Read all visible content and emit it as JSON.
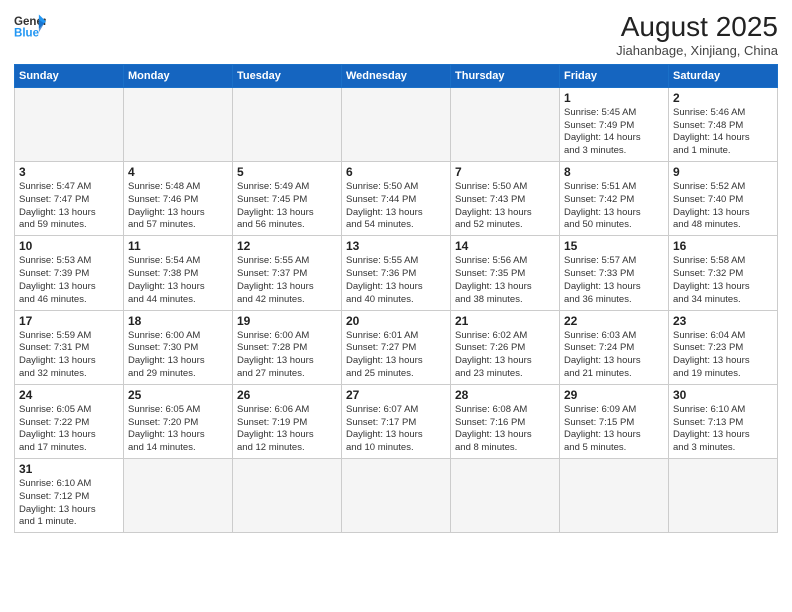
{
  "header": {
    "logo_general": "General",
    "logo_blue": "Blue",
    "month_title": "August 2025",
    "location": "Jiahanbage, Xinjiang, China"
  },
  "weekdays": [
    "Sunday",
    "Monday",
    "Tuesday",
    "Wednesday",
    "Thursday",
    "Friday",
    "Saturday"
  ],
  "days": [
    {
      "date": "",
      "info": ""
    },
    {
      "date": "",
      "info": ""
    },
    {
      "date": "",
      "info": ""
    },
    {
      "date": "",
      "info": ""
    },
    {
      "date": "",
      "info": ""
    },
    {
      "date": "1",
      "info": "Sunrise: 5:45 AM\nSunset: 7:49 PM\nDaylight: 14 hours\nand 3 minutes."
    },
    {
      "date": "2",
      "info": "Sunrise: 5:46 AM\nSunset: 7:48 PM\nDaylight: 14 hours\nand 1 minute."
    },
    {
      "date": "3",
      "info": "Sunrise: 5:47 AM\nSunset: 7:47 PM\nDaylight: 13 hours\nand 59 minutes."
    },
    {
      "date": "4",
      "info": "Sunrise: 5:48 AM\nSunset: 7:46 PM\nDaylight: 13 hours\nand 57 minutes."
    },
    {
      "date": "5",
      "info": "Sunrise: 5:49 AM\nSunset: 7:45 PM\nDaylight: 13 hours\nand 56 minutes."
    },
    {
      "date": "6",
      "info": "Sunrise: 5:50 AM\nSunset: 7:44 PM\nDaylight: 13 hours\nand 54 minutes."
    },
    {
      "date": "7",
      "info": "Sunrise: 5:50 AM\nSunset: 7:43 PM\nDaylight: 13 hours\nand 52 minutes."
    },
    {
      "date": "8",
      "info": "Sunrise: 5:51 AM\nSunset: 7:42 PM\nDaylight: 13 hours\nand 50 minutes."
    },
    {
      "date": "9",
      "info": "Sunrise: 5:52 AM\nSunset: 7:40 PM\nDaylight: 13 hours\nand 48 minutes."
    },
    {
      "date": "10",
      "info": "Sunrise: 5:53 AM\nSunset: 7:39 PM\nDaylight: 13 hours\nand 46 minutes."
    },
    {
      "date": "11",
      "info": "Sunrise: 5:54 AM\nSunset: 7:38 PM\nDaylight: 13 hours\nand 44 minutes."
    },
    {
      "date": "12",
      "info": "Sunrise: 5:55 AM\nSunset: 7:37 PM\nDaylight: 13 hours\nand 42 minutes."
    },
    {
      "date": "13",
      "info": "Sunrise: 5:55 AM\nSunset: 7:36 PM\nDaylight: 13 hours\nand 40 minutes."
    },
    {
      "date": "14",
      "info": "Sunrise: 5:56 AM\nSunset: 7:35 PM\nDaylight: 13 hours\nand 38 minutes."
    },
    {
      "date": "15",
      "info": "Sunrise: 5:57 AM\nSunset: 7:33 PM\nDaylight: 13 hours\nand 36 minutes."
    },
    {
      "date": "16",
      "info": "Sunrise: 5:58 AM\nSunset: 7:32 PM\nDaylight: 13 hours\nand 34 minutes."
    },
    {
      "date": "17",
      "info": "Sunrise: 5:59 AM\nSunset: 7:31 PM\nDaylight: 13 hours\nand 32 minutes."
    },
    {
      "date": "18",
      "info": "Sunrise: 6:00 AM\nSunset: 7:30 PM\nDaylight: 13 hours\nand 29 minutes."
    },
    {
      "date": "19",
      "info": "Sunrise: 6:00 AM\nSunset: 7:28 PM\nDaylight: 13 hours\nand 27 minutes."
    },
    {
      "date": "20",
      "info": "Sunrise: 6:01 AM\nSunset: 7:27 PM\nDaylight: 13 hours\nand 25 minutes."
    },
    {
      "date": "21",
      "info": "Sunrise: 6:02 AM\nSunset: 7:26 PM\nDaylight: 13 hours\nand 23 minutes."
    },
    {
      "date": "22",
      "info": "Sunrise: 6:03 AM\nSunset: 7:24 PM\nDaylight: 13 hours\nand 21 minutes."
    },
    {
      "date": "23",
      "info": "Sunrise: 6:04 AM\nSunset: 7:23 PM\nDaylight: 13 hours\nand 19 minutes."
    },
    {
      "date": "24",
      "info": "Sunrise: 6:05 AM\nSunset: 7:22 PM\nDaylight: 13 hours\nand 17 minutes."
    },
    {
      "date": "25",
      "info": "Sunrise: 6:05 AM\nSunset: 7:20 PM\nDaylight: 13 hours\nand 14 minutes."
    },
    {
      "date": "26",
      "info": "Sunrise: 6:06 AM\nSunset: 7:19 PM\nDaylight: 13 hours\nand 12 minutes."
    },
    {
      "date": "27",
      "info": "Sunrise: 6:07 AM\nSunset: 7:17 PM\nDaylight: 13 hours\nand 10 minutes."
    },
    {
      "date": "28",
      "info": "Sunrise: 6:08 AM\nSunset: 7:16 PM\nDaylight: 13 hours\nand 8 minutes."
    },
    {
      "date": "29",
      "info": "Sunrise: 6:09 AM\nSunset: 7:15 PM\nDaylight: 13 hours\nand 5 minutes."
    },
    {
      "date": "30",
      "info": "Sunrise: 6:10 AM\nSunset: 7:13 PM\nDaylight: 13 hours\nand 3 minutes."
    },
    {
      "date": "31",
      "info": "Sunrise: 6:10 AM\nSunset: 7:12 PM\nDaylight: 13 hours\nand 1 minute."
    },
    {
      "date": "",
      "info": ""
    },
    {
      "date": "",
      "info": ""
    },
    {
      "date": "",
      "info": ""
    },
    {
      "date": "",
      "info": ""
    },
    {
      "date": "",
      "info": ""
    },
    {
      "date": "",
      "info": ""
    }
  ]
}
